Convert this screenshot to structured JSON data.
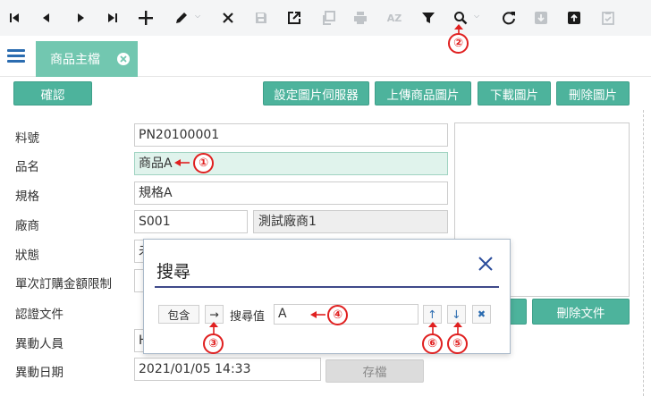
{
  "toolbar": {
    "icons": [
      "first-icon",
      "prev-icon",
      "next-icon",
      "last-icon",
      "add-icon",
      "edit-icon",
      "delete-icon",
      "save-icon",
      "export-icon",
      "copy-icon",
      "print-icon",
      "sort-icon",
      "filter-icon",
      "search-icon",
      "refresh-icon",
      "download-icon",
      "upload-icon",
      "clipboard-icon"
    ]
  },
  "tabs": [
    {
      "label": "商品主檔"
    }
  ],
  "buttons": {
    "confirm": "確認",
    "set_image_server": "設定圖片伺服器",
    "upload_image": "上傳商品圖片",
    "download_image": "下載圖片",
    "delete_image": "刪除圖片",
    "delete_file": "刪除文件",
    "save": "存檔"
  },
  "form": {
    "part_no": {
      "label": "料號",
      "value": "PN20100001"
    },
    "name": {
      "label": "品名",
      "value": "商品A"
    },
    "spec": {
      "label": "規格",
      "value": "規格A"
    },
    "vendor": {
      "label": "廠商",
      "code": "S001",
      "name": "測試廠商1"
    },
    "status": {
      "label": "狀態",
      "value": "未"
    },
    "order_limit": {
      "label": "單次訂購金額限制"
    },
    "cert_docs": {
      "label": "認證文件"
    },
    "modifier": {
      "label": "異動人員",
      "value": "H"
    },
    "modified_date": {
      "label": "異動日期",
      "value": "2021/01/05 14:33"
    }
  },
  "search_dialog": {
    "title": "搜尋",
    "mode": "包含",
    "direction_symbol": "→",
    "search_label": "搜尋值",
    "search_value": "A",
    "up_symbol": "↑",
    "down_symbol": "↓",
    "clear_symbol": "✖"
  },
  "annotations": [
    "①",
    "②",
    "③",
    "④",
    "⑤",
    "⑥"
  ],
  "colors": {
    "accent": "#4db39c",
    "tab": "#72c7b0",
    "highlight_field": "#e0f3ec",
    "annotation": "#e02020",
    "dialog_rule": "#3f4a8a"
  }
}
